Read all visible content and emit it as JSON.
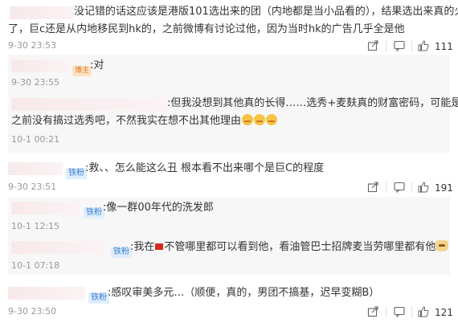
{
  "comments": [
    {
      "lines": [
        "没记错的话这应该是港版101选出来的团（内地都是当小品看的），结果选出来真的火",
        "了，巨c还是从内地移民到hk的，之前微博有讨论过他，因为当时hk的广告几乎全是他"
      ],
      "time": "9-30 23:53",
      "like_count": "111",
      "replies": [
        {
          "badge": "博主",
          "text": ":对",
          "time": "9-30 23:55"
        },
        {
          "lines": [
            ":但我没想到其他真的长得……选秀+麦麸真的财富密码，可能是hk",
            "之前没有搞过选秀吧，不然我实在想不出其他理由"
          ],
          "time": "10-1 00:21"
        }
      ]
    },
    {
      "badge": "铁粉",
      "text": ":救、、怎么能这么丑 根本看不出来哪个是巨C的程度",
      "time": "9-30 23:51",
      "like_count": "191",
      "replies": [
        {
          "badge": "铁粉",
          "text": ":像一群00年代的洗发郎",
          "time": "10-1 12:15"
        },
        {
          "badge": "铁粉",
          "text_before_flag": ":我在",
          "text_after_flag": "不管哪里都可以看到他，看油管巴士招牌麦当劳哪里都有他",
          "time": "10-1 07:18"
        }
      ]
    },
    {
      "badge": "铁粉",
      "text": ":感叹审美多元…（顺便，真的，男团不搞基，迟早变糊B）",
      "time": "9-30 23:50",
      "like_count": "121"
    }
  ],
  "icons": [
    "share-icon",
    "comment-icon",
    "like-icon"
  ]
}
